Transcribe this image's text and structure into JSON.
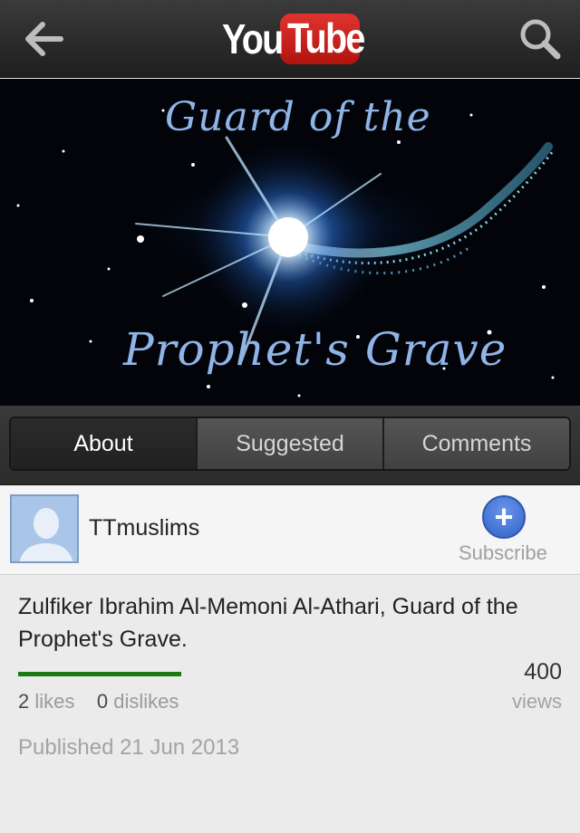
{
  "header": {
    "logo_you": "You",
    "logo_tube": "Tube",
    "back_icon": "back-arrow-icon",
    "search_icon": "search-icon"
  },
  "video": {
    "title_line1": "Guard of the",
    "title_line2": "Prophet's Grave"
  },
  "tabs": [
    {
      "label": "About",
      "selected": true
    },
    {
      "label": "Suggested",
      "selected": false
    },
    {
      "label": "Comments",
      "selected": false
    }
  ],
  "channel": {
    "name": "TTmuslims",
    "subscribe_label": "Subscribe",
    "subscribe_icon": "plus-icon",
    "avatar_icon": "default-avatar-icon"
  },
  "info": {
    "description": "Zulfiker Ibrahim Al-Memoni Al-Athari, Guard of the Prophet's Grave.",
    "likes_count": "2",
    "likes_label": "likes",
    "dislikes_count": "0",
    "dislikes_label": "dislikes",
    "like_ratio": 1.0,
    "views_count": "400",
    "views_label": "views",
    "published": "Published 21 Jun 2013"
  },
  "colors": {
    "like_bar": "#1d7a12",
    "title_text": "#8fb4e6",
    "subscribe": "#3f6fd4"
  }
}
